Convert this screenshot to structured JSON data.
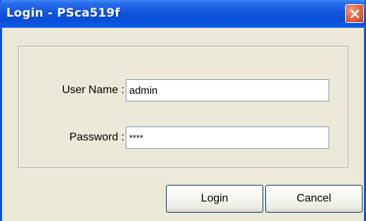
{
  "window": {
    "title": "Login - PSca519f"
  },
  "form": {
    "username_label": "User Name :",
    "username_value": "admin",
    "password_label": "Password :",
    "password_value": "****"
  },
  "buttons": {
    "login_label": "Login",
    "cancel_label": "Cancel"
  },
  "colors": {
    "titlebar": "#0A4FD8",
    "close_button": "#E26A45",
    "window_bg": "#ECE9D8"
  },
  "icons": {
    "close": "close-icon"
  }
}
